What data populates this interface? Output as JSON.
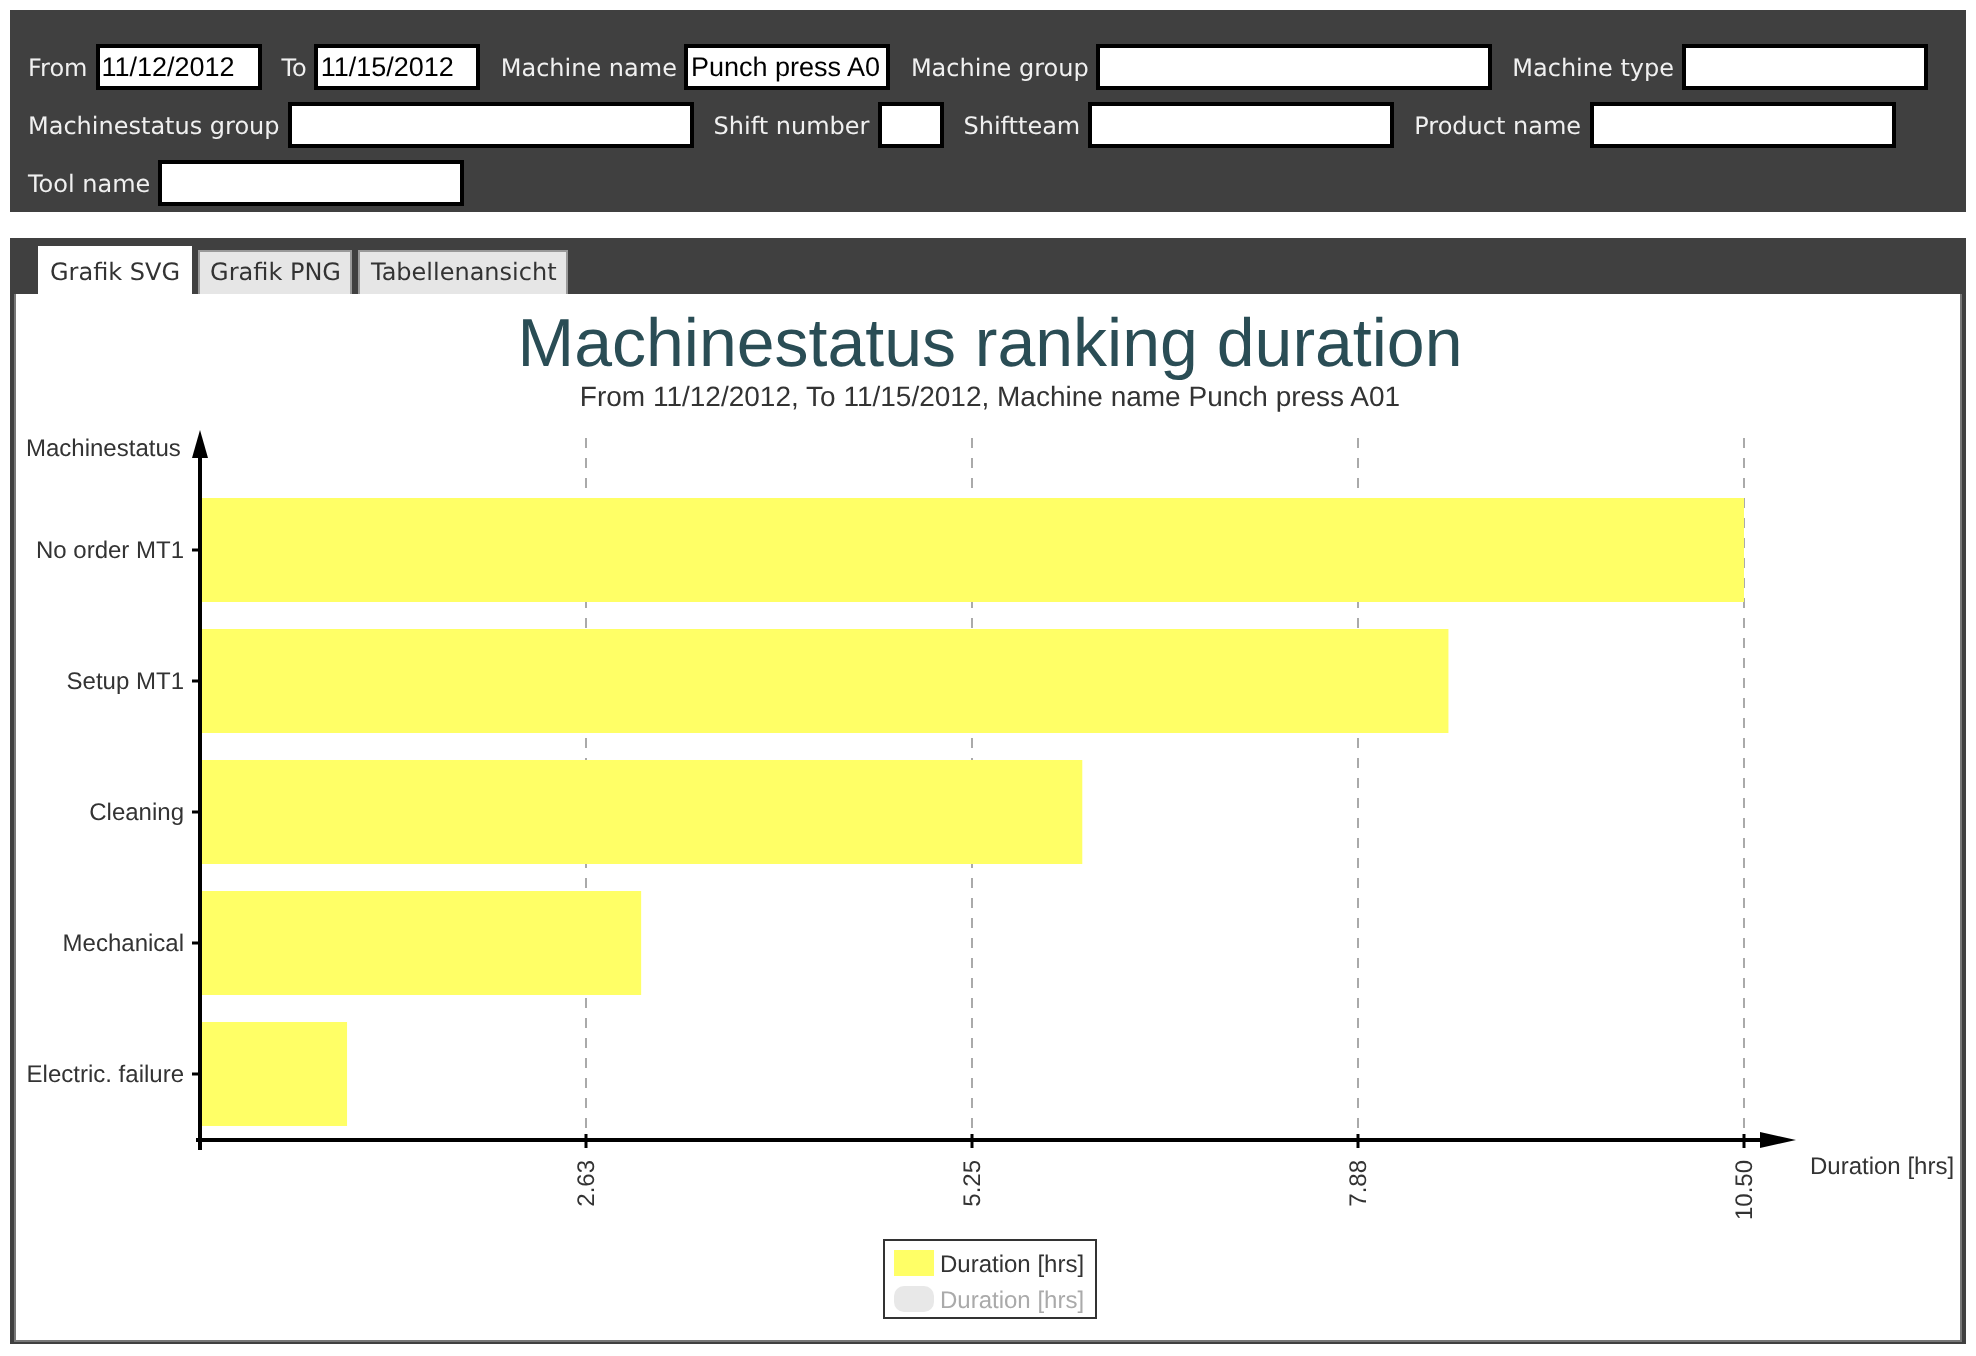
{
  "filter_rows": [
    {
      "fields": [
        {
          "label": "From",
          "value": "11/12/2012"
        },
        {
          "label": "To",
          "value": "11/15/2012"
        },
        {
          "label": "Machine name",
          "value": "Punch press A0"
        },
        {
          "label": "Machine group"
        },
        {
          "label": "Machine type"
        }
      ]
    },
    {
      "fields": [
        {
          "label": "Machinestatus group"
        },
        {
          "label": "Shift number"
        },
        {
          "label": "Shiftteam"
        },
        {
          "label": "Product name"
        }
      ]
    },
    {
      "fields": [
        {
          "label": "Tool name"
        }
      ]
    }
  ],
  "tabs": [
    {
      "label": "Grafik SVG",
      "selected": true
    },
    {
      "label": "Grafik PNG",
      "selected": false
    },
    {
      "label": "Tabellenansicht",
      "selected": false
    }
  ],
  "chart": {
    "chart_data": {
      "type": "bar",
      "orientation": "horizontal",
      "title": "Machinestatus ranking duration",
      "subtitle": "From 11/12/2012, To 11/15/2012, Machine name Punch press A01",
      "xlabel": "Duration [hrs]",
      "ylabel": "Machinestatus",
      "categories": [
        "No order MT1",
        "Setup MT1",
        "Cleaning",
        "Mechanical",
        "Electric. failure"
      ],
      "xlim": [
        0,
        10.5
      ],
      "grid": true,
      "xticks": [
        {
          "value": 2.625,
          "label": "2.63"
        },
        {
          "value": 5.25,
          "label": "5.25"
        },
        {
          "value": 7.875,
          "label": "7.88"
        },
        {
          "value": 10.5,
          "label": "10.50"
        }
      ],
      "series": [
        {
          "name": "Duration [hrs]",
          "color": "#ffff66",
          "values": [
            10.5,
            8.49,
            6.0,
            3.0,
            1.0
          ]
        }
      ]
    },
    "legend": [
      {
        "disabled": false
      },
      {
        "label": "Duration [hrs]",
        "color": "#e8e8e8",
        "disabled": true
      }
    ]
  }
}
